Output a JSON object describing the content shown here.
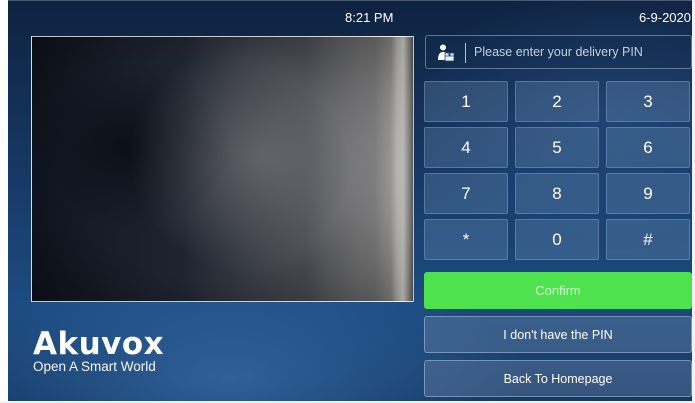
{
  "status_bar": {
    "time": "8:21 PM",
    "date": "6-9-2020"
  },
  "video_preview": {
    "icon": "camera-feed"
  },
  "branding": {
    "name": "Akuvox",
    "tagline": "Open A Smart World"
  },
  "pin_entry": {
    "icon": "delivery-person-icon",
    "placeholder": "Please enter your delivery PIN",
    "value": ""
  },
  "keypad": {
    "keys": [
      "1",
      "2",
      "3",
      "4",
      "5",
      "6",
      "7",
      "8",
      "9",
      "*",
      "0",
      "#"
    ]
  },
  "buttons": {
    "confirm": "Confirm",
    "no_pin": "I don't have the PIN",
    "back_home": "Back To Homepage"
  },
  "colors": {
    "confirm_green": "#4ee24f",
    "background_blue": "#163a66"
  }
}
